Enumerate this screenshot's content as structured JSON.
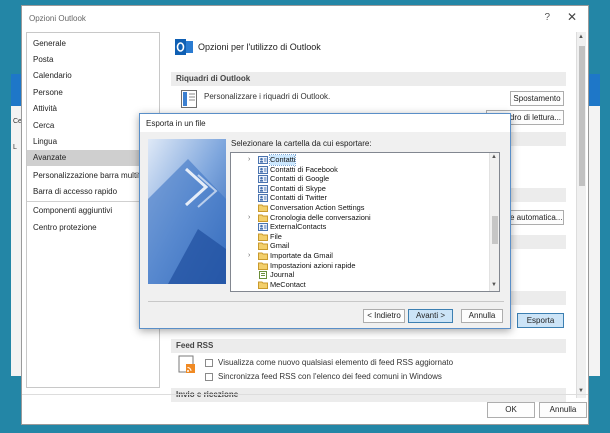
{
  "options_window": {
    "title": "Opzioni Outlook",
    "help_glyph": "?",
    "close_glyph": "✕",
    "nav": [
      "Generale",
      "Posta",
      "Calendario",
      "Persone",
      "Attività",
      "Cerca",
      "Lingua",
      "Avanzate",
      "Personalizzazione barra multifunzione",
      "Barra di accesso rapido",
      "Componenti aggiuntivi",
      "Centro protezione"
    ],
    "selected_nav": "Avanzate",
    "heading": "Opzioni per l'utilizzo di Outlook",
    "section_riquadri": "Riquadri di Outlook",
    "riquadri_text": "Personalizzare i riquadri di Outlook.",
    "btn_spostamento": "Spostamento",
    "btn_riquadro_lettura": "Riquadro di lettura...",
    "btn_automatica": "e automatica...",
    "btn_esporta": "Esporta",
    "section_feed": "Feed RSS",
    "feed_option1": "Visualizza come nuovo qualsiasi elemento di feed RSS aggiornato",
    "feed_option2": "Sincronizza feed RSS con l'elenco dei feed comuni in Windows",
    "section_invio": "Invio e ricezione",
    "btn_ok": "OK",
    "btn_annulla": "Annulla",
    "left_fragments": [
      "Cerca",
      "L"
    ]
  },
  "export_dialog": {
    "title": "Esporta in un file",
    "prompt": "Selezionare la cartella da cui esportare:",
    "tree": [
      {
        "label": "Contatti",
        "icon": "contacts-icon",
        "expandable": true,
        "selected": true
      },
      {
        "label": "Contatti di Facebook",
        "icon": "contacts-icon",
        "expandable": false
      },
      {
        "label": "Contatti di Google",
        "icon": "contacts-icon",
        "expandable": false
      },
      {
        "label": "Contatti di Skype",
        "icon": "contacts-icon",
        "expandable": false
      },
      {
        "label": "Contatti di Twitter",
        "icon": "contacts-icon",
        "expandable": false
      },
      {
        "label": "Conversation Action Settings",
        "icon": "folder-icon",
        "expandable": false
      },
      {
        "label": "Cronologia delle conversazioni",
        "icon": "folder-icon",
        "expandable": true
      },
      {
        "label": "ExternalContacts",
        "icon": "contacts-icon",
        "expandable": false
      },
      {
        "label": "File",
        "icon": "folder-icon",
        "expandable": false
      },
      {
        "label": "Gmail",
        "icon": "folder-icon",
        "expandable": false
      },
      {
        "label": "Importate da Gmail",
        "icon": "folder-icon",
        "expandable": true
      },
      {
        "label": "Impostazioni azioni rapide",
        "icon": "folder-icon",
        "expandable": false
      },
      {
        "label": "Journal",
        "icon": "journal-icon",
        "expandable": false
      },
      {
        "label": "MeContact",
        "icon": "folder-icon",
        "expandable": false
      }
    ],
    "btn_back": "< Indietro",
    "btn_next": "Avanti >",
    "btn_cancel": "Annulla"
  },
  "colors": {
    "desktop": "#2386a6",
    "accent": "#1e77c8",
    "selection": "#cce8ff",
    "button_focus": "#cce4f7"
  }
}
